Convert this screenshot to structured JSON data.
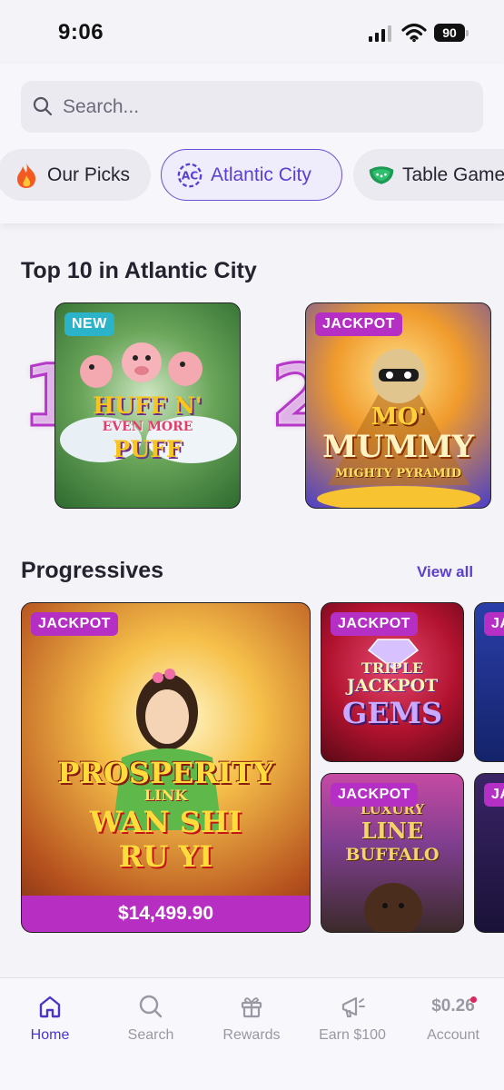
{
  "status_bar": {
    "time": "9:06",
    "battery": "90"
  },
  "search": {
    "placeholder": "Search..."
  },
  "categories": [
    {
      "label": "Our Picks",
      "icon": "fire-icon"
    },
    {
      "label": "Atlantic City",
      "icon": "atlantic-city-icon",
      "active": true
    },
    {
      "label": "Table Games",
      "icon": "table-games-icon"
    }
  ],
  "top10": {
    "title": "Top 10 in Atlantic City",
    "items": [
      {
        "rank": "1",
        "badge": "NEW",
        "game_lines": [
          "HUFF N'",
          "EVEN MORE",
          "PUFF"
        ]
      },
      {
        "rank": "2",
        "badge": "JACKPOT",
        "game_lines": [
          "MO'",
          "MUMMY",
          "MIGHTY PYRAMID"
        ]
      }
    ]
  },
  "progressives": {
    "title": "Progressives",
    "view_all": "View all",
    "featured": {
      "badge": "JACKPOT",
      "game_lines": [
        "PROSPERITY",
        "LINK",
        "WAN SHI",
        "RU YI"
      ],
      "amount": "$14,499.90"
    },
    "small": [
      {
        "badge": "JACKPOT",
        "game_lines": [
          "TRIPLE",
          "JACKPOT",
          "GEMS"
        ]
      },
      {
        "badge": "JACKPOT",
        "game_lines": [
          "LUXURY",
          "LINE",
          "BUFFALO"
        ]
      }
    ],
    "partial_badge": "JA"
  },
  "bottom_nav": [
    {
      "label": "Home",
      "icon": "home-icon",
      "active": true
    },
    {
      "label": "Search",
      "icon": "search-icon"
    },
    {
      "label": "Rewards",
      "icon": "gift-icon"
    },
    {
      "label": "Earn $100",
      "icon": "megaphone-icon"
    },
    {
      "label": "Account",
      "balance": "$0.26"
    }
  ],
  "colors": {
    "accent": "#5b3fd0",
    "jackpot": "#b52fc4",
    "new_badge": "#2bb3c9"
  }
}
